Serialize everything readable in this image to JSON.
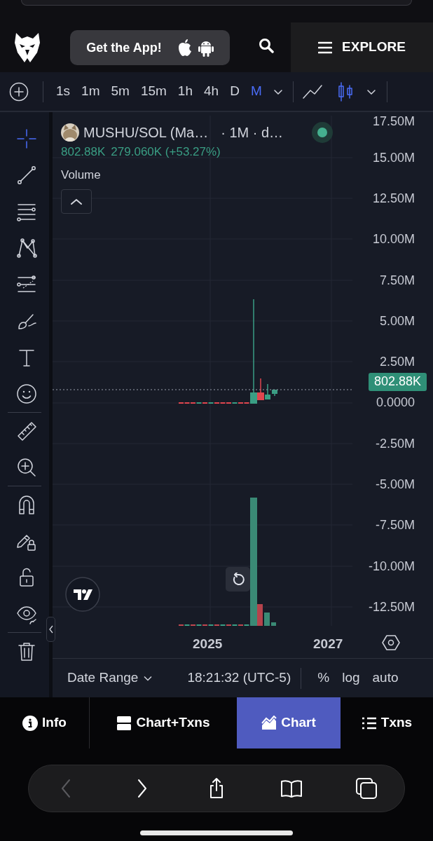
{
  "header": {
    "app_button": {
      "label": "Get the App!"
    },
    "explore": {
      "label": "EXPLORE"
    }
  },
  "toolbar": {
    "timeframes": [
      {
        "label": "1s",
        "selected": false
      },
      {
        "label": "1m",
        "selected": false
      },
      {
        "label": "5m",
        "selected": false
      },
      {
        "label": "15m",
        "selected": false
      },
      {
        "label": "1h",
        "selected": false
      },
      {
        "label": "4h",
        "selected": false
      },
      {
        "label": "D",
        "selected": false
      },
      {
        "label": "M",
        "selected": true
      }
    ],
    "chart_types": [
      {
        "kind": "line",
        "selected": false
      },
      {
        "kind": "candles",
        "selected": true
      }
    ]
  },
  "drawing_tools": [
    [
      {
        "kind": "crosshair",
        "selected": true
      },
      {
        "kind": "trend-line",
        "selected": false
      },
      {
        "kind": "fib",
        "selected": false
      },
      {
        "kind": "pattern",
        "selected": false
      },
      {
        "kind": "projection",
        "selected": false
      },
      {
        "kind": "brush",
        "selected": false
      },
      {
        "kind": "text",
        "selected": false
      },
      {
        "kind": "emoji",
        "selected": false
      }
    ],
    [
      {
        "kind": "ruler",
        "selected": false
      },
      {
        "kind": "zoom",
        "selected": false
      }
    ],
    [
      {
        "kind": "magnet",
        "selected": false
      },
      {
        "kind": "pencil-lock",
        "selected": false
      },
      {
        "kind": "lock",
        "selected": false
      },
      {
        "kind": "eye",
        "selected": false
      }
    ],
    [
      {
        "kind": "trash",
        "selected": false
      }
    ]
  ],
  "chart": {
    "legend": {
      "symbol": "MUSHU/SOL (Ma…",
      "details": "· 1M · d…",
      "price": "802.88K",
      "change": "279.060K (+53.27%)",
      "indicator": "Volume"
    },
    "y_axis": [
      "17.50M",
      "15.00M",
      "12.50M",
      "10.00M",
      "7.50M",
      "5.00M",
      "2.50M",
      "0.0000",
      "-2.50M",
      "-5.00M",
      "-7.50M",
      "-10.00M",
      "-12.50M"
    ],
    "price_tag": "802.88K",
    "x_axis": [
      "2025",
      "2027"
    ]
  },
  "footer": {
    "date_range": "Date Range",
    "time": "18:21:32 (UTC-5)",
    "options": [
      "%",
      "log",
      "auto"
    ]
  },
  "tabs": [
    {
      "kind": "info",
      "label": "Info",
      "selected": false
    },
    {
      "kind": "split",
      "label": "Chart+Txns",
      "selected": false
    },
    {
      "kind": "chart",
      "label": "Chart",
      "selected": true
    },
    {
      "kind": "list",
      "label": "Txns",
      "selected": false
    }
  ],
  "browser_toolbar": [
    {
      "kind": "back",
      "disabled": true
    },
    {
      "kind": "forward",
      "disabled": false
    },
    {
      "kind": "share",
      "disabled": false
    },
    {
      "kind": "bookmarks",
      "disabled": false
    },
    {
      "kind": "tabs",
      "disabled": false
    }
  ]
}
